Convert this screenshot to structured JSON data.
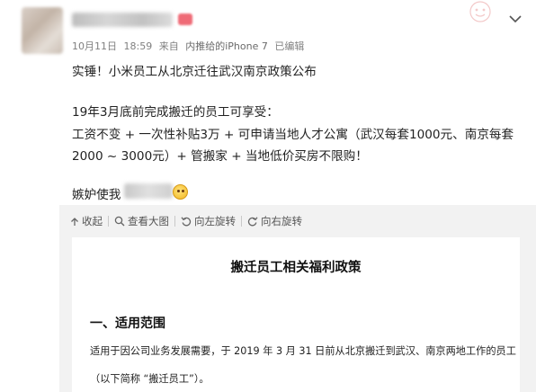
{
  "post": {
    "date": "10月11日",
    "time": "18:59",
    "source_prefix": "来自",
    "source": "内推给的iPhone 7",
    "edited": "已编辑",
    "body_lines": [
      "实锤！小米员工从北京迁往武汉南京政策公布",
      "19年3月底前完成搬迁的员工可享受：",
      "工资不变 + 一次性补贴3万 + 可申请当地人才公寓（武汉每套1000元、南京每套",
      "2000 ~ 3000元）+ 管搬家 + 当地低价买房不限购！",
      "嫉妒使我"
    ]
  },
  "toolbar": {
    "collapse": "收起",
    "view_large": "查看大图",
    "rotate_left": "向左旋转",
    "rotate_right": "向右旋转"
  },
  "document": {
    "title": "搬迁员工相关福利政策",
    "section_heading": "一、适用范围",
    "paragraph_line1": "适用于因公司业务发展需要，于 2019 年 3 月 31 日前从北京搬迁到武汉、南京两地工作的员工",
    "paragraph_line2": "（以下简称 “搬迁员工”）。"
  },
  "icons": {
    "collapse": "arrow-up-icon",
    "view_large": "zoom-icon",
    "rotate_left": "rotate-left-icon",
    "rotate_right": "rotate-right-icon",
    "menu": "chevron-down-icon"
  },
  "colors": {
    "meta_text": "#808080",
    "body_text": "#222222",
    "media_background": "#f2f2f2"
  }
}
